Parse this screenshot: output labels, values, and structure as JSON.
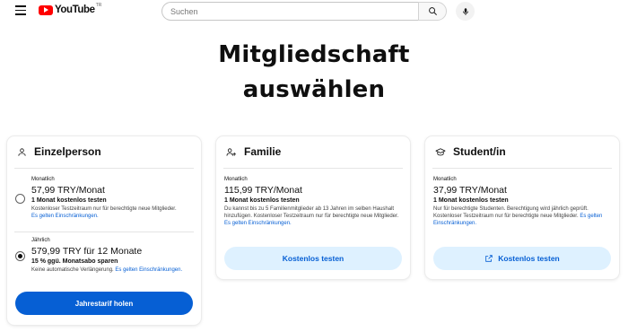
{
  "header": {
    "logo_text": "YouTube",
    "logo_region": "TR",
    "search_placeholder": "Suchen",
    "icons": [
      "menu-icon",
      "youtube-logo-icon",
      "search-icon",
      "mic-icon"
    ]
  },
  "page_title_line1": "Mitgliedschaft",
  "page_title_line2": "auswählen",
  "colors": {
    "accent": "#065fd4",
    "accent_light": "#def1ff",
    "brand_red": "#ff0000"
  },
  "cards": [
    {
      "title": "Einzelperson",
      "icon": "person-icon",
      "plans": [
        {
          "label": "Monatlich",
          "price": "57,99 TRY/Monat",
          "free": "1 Monat kostenlos testen",
          "note": "Kostenloser Testzeitraum nur für berechtigte neue Mitglieder.",
          "link": "Es gelten Einschränkungen.",
          "selected": false
        },
        {
          "label": "Jährlich",
          "price": "579,99 TRY für 12 Monate",
          "free": "15 % ggü. Monatsabo sparen",
          "note": "Keine automatische Verlängerung.",
          "link": "Es gelten Einschränkungen.",
          "selected": true
        }
      ],
      "button": "Jahrestarif holen"
    },
    {
      "title": "Familie",
      "icon": "family-icon",
      "label": "Monatlich",
      "price": "115,99 TRY/Monat",
      "free": "1 Monat kostenlos testen",
      "note": "Du kannst bis zu 5 Familienmitglieder ab 13 Jahren im selben Haushalt hinzufügen. Kostenloser Testzeitraum nur für berechtigte neue Mitglieder.",
      "link": "Es gelten Einschränkungen.",
      "button": "Kostenlos testen"
    },
    {
      "title": "Student/in",
      "icon": "graduation-cap-icon",
      "label": "Monatlich",
      "price": "37,99 TRY/Monat",
      "free": "1 Monat kostenlos testen",
      "note": "Nur für berechtigte Studenten. Berechtigung wird jährlich geprüft. Kostenloser Testzeitraum nur für berechtigte neue Mitglieder.",
      "link": "Es gelten Einschränkungen.",
      "button": "Kostenlos testen",
      "button_icon": "external-link-icon"
    }
  ]
}
